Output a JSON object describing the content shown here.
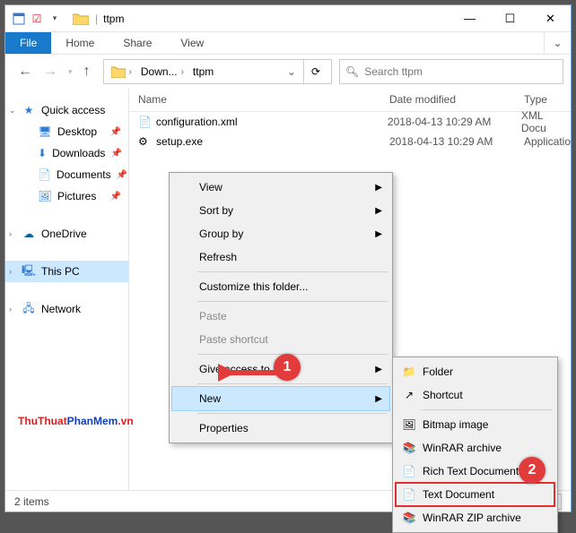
{
  "title": "ttpm",
  "menubar": {
    "file": "File",
    "home": "Home",
    "share": "Share",
    "view": "View"
  },
  "breadcrumb": {
    "parent": "Down...",
    "current": "ttpm"
  },
  "search": {
    "placeholder": "Search ttpm"
  },
  "sidebar": {
    "quickaccess": "Quick access",
    "items": [
      {
        "label": "Desktop"
      },
      {
        "label": "Downloads"
      },
      {
        "label": "Documents"
      },
      {
        "label": "Pictures"
      }
    ],
    "onedrive": "OneDrive",
    "thispc": "This PC",
    "network": "Network"
  },
  "columns": {
    "name": "Name",
    "date": "Date modified",
    "type": "Type"
  },
  "files": [
    {
      "name": "configuration.xml",
      "date": "2018-04-13 10:29 AM",
      "type": "XML Docu"
    },
    {
      "name": "setup.exe",
      "date": "2018-04-13 10:29 AM",
      "type": "Applicatio"
    }
  ],
  "status": "2 items",
  "context1": {
    "view": "View",
    "sortby": "Sort by",
    "groupby": "Group by",
    "refresh": "Refresh",
    "customize": "Customize this folder...",
    "paste": "Paste",
    "pasteshortcut": "Paste shortcut",
    "giveaccess": "Give access to",
    "new": "New",
    "properties": "Properties"
  },
  "context2": {
    "folder": "Folder",
    "shortcut": "Shortcut",
    "bitmap": "Bitmap image",
    "winrar": "WinRAR archive",
    "rtf": "Rich Text Document",
    "txt": "Text Document",
    "zip": "WinRAR ZIP archive"
  },
  "badges": {
    "one": "1",
    "two": "2"
  },
  "watermark": {
    "a": "ThuThuat",
    "b": "PhanMem",
    "c": ".vn"
  }
}
